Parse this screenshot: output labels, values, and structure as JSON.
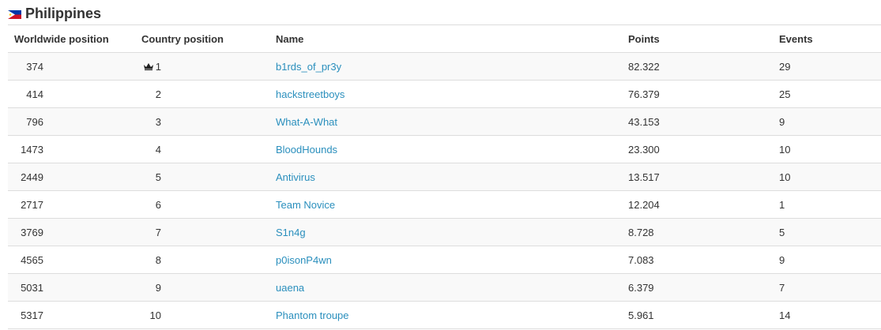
{
  "country": {
    "name": "Philippines",
    "flag_icon": "philippines-flag-icon"
  },
  "columns": {
    "worldwide": "Worldwide position",
    "country": "Country position",
    "name": "Name",
    "points": "Points",
    "events": "Events"
  },
  "colors": {
    "link": "#2a8fbd",
    "stripe": "#f9f9f9",
    "border": "#dddddd"
  },
  "rows": [
    {
      "worldwide": "374",
      "country": "1",
      "name": "b1rds_of_pr3y",
      "points": "82.322",
      "events": "29",
      "crown": true
    },
    {
      "worldwide": "414",
      "country": "2",
      "name": "hackstreetboys",
      "points": "76.379",
      "events": "25"
    },
    {
      "worldwide": "796",
      "country": "3",
      "name": "What-A-What",
      "points": "43.153",
      "events": "9"
    },
    {
      "worldwide": "1473",
      "country": "4",
      "name": "BloodHounds",
      "points": "23.300",
      "events": "10"
    },
    {
      "worldwide": "2449",
      "country": "5",
      "name": "Antivirus",
      "points": "13.517",
      "events": "10"
    },
    {
      "worldwide": "2717",
      "country": "6",
      "name": "Team Novice",
      "points": "12.204",
      "events": "1"
    },
    {
      "worldwide": "3769",
      "country": "7",
      "name": "S1n4g",
      "points": "8.728",
      "events": "5"
    },
    {
      "worldwide": "4565",
      "country": "8",
      "name": "p0isonP4wn",
      "points": "7.083",
      "events": "9"
    },
    {
      "worldwide": "5031",
      "country": "9",
      "name": "uaena",
      "points": "6.379",
      "events": "7"
    },
    {
      "worldwide": "5317",
      "country": "10",
      "name": "Phantom troupe",
      "points": "5.961",
      "events": "14"
    }
  ]
}
